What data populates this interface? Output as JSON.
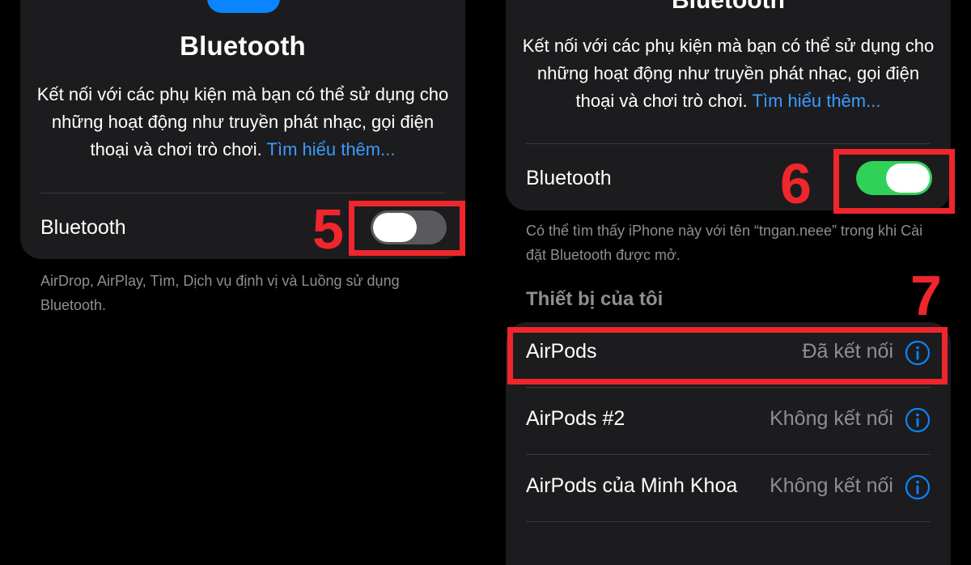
{
  "left_screen": {
    "title": "Bluetooth",
    "description": "Kết nối với các phụ kiện mà bạn có thể sử dụng cho những hoạt động như truyền phát nhạc, gọi điện thoại và chơi trò chơi.",
    "learn_more": "Tìm hiểu thêm...",
    "bluetooth_label": "Bluetooth",
    "bluetooth_toggle": "off",
    "footer": "AirDrop, AirPlay, Tìm, Dịch vụ định vị và Luồng sử dụng Bluetooth.",
    "step_number": "5"
  },
  "right_screen": {
    "title": "Bluetooth",
    "description": "Kết nối với các phụ kiện mà bạn có thể sử dụng cho những hoạt động như truyền phát nhạc, gọi điện thoại và chơi trò chơi.",
    "learn_more": "Tìm hiểu thêm...",
    "bluetooth_label": "Bluetooth",
    "bluetooth_toggle": "on",
    "footer": "Có thể tìm thấy iPhone này với tên “tngan.neee” trong khi Cài đặt Bluetooth được mở.",
    "step_number_toggle": "6",
    "step_number_device": "7",
    "section_header": "Thiết bị của tôi",
    "devices": [
      {
        "name": "AirPods",
        "status": "Đã kết nối",
        "icon": "info-icon"
      },
      {
        "name": "AirPods #2",
        "status": "Không kết nối",
        "icon": "info-icon"
      },
      {
        "name": "AirPods của Minh Khoa",
        "status": "Không kết nối",
        "icon": "info-icon"
      }
    ]
  },
  "colors": {
    "accent_blue": "#0a84ff",
    "toggle_on": "#30d158",
    "annotation_red": "#f0262c"
  }
}
